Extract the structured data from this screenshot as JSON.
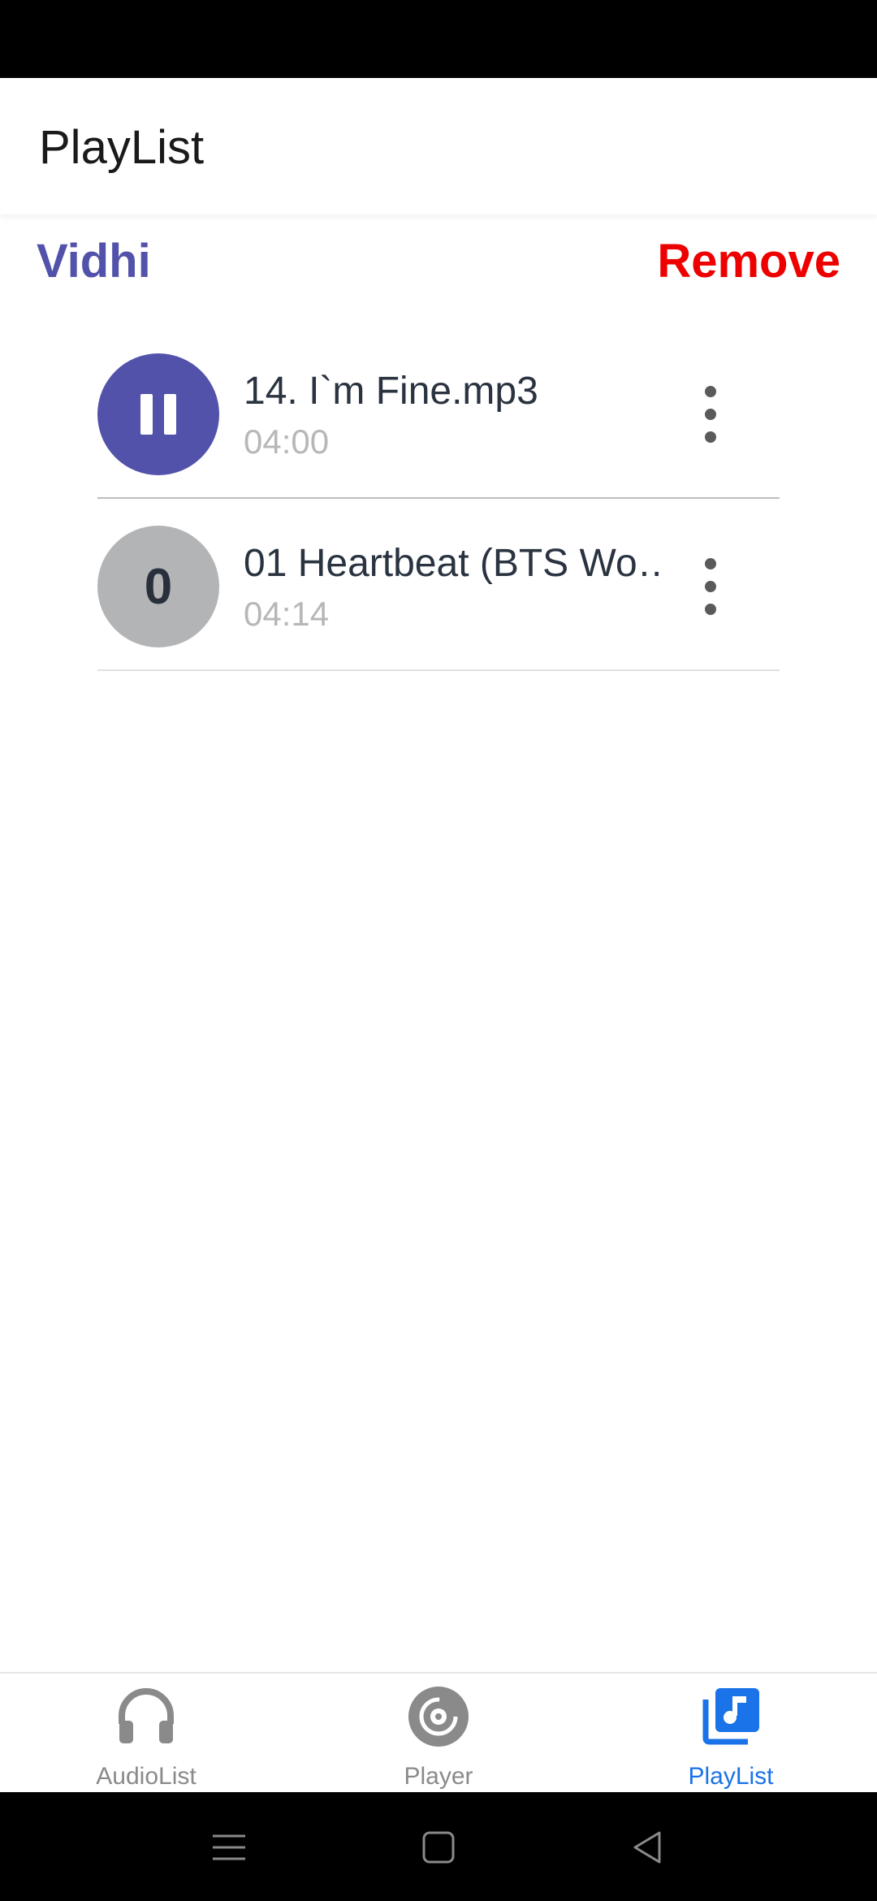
{
  "header": {
    "title": "PlayList"
  },
  "playlist": {
    "name": "Vidhi",
    "remove_label": "Remove"
  },
  "tracks": [
    {
      "title": "14. I`m Fine.mp3",
      "duration": "04:00",
      "state": "playing",
      "avatar_icon": "pause-icon"
    },
    {
      "title": "01 Heartbeat (BTS Wo…",
      "duration": "04:14",
      "state": "idle",
      "avatar_text": "0"
    }
  ],
  "bottom_nav": {
    "tabs": [
      {
        "label": "AudioList",
        "icon": "headphones-icon",
        "active": false
      },
      {
        "label": "Player",
        "icon": "disc-icon",
        "active": false
      },
      {
        "label": "PlayList",
        "icon": "music-library-icon",
        "active": true
      }
    ]
  },
  "colors": {
    "accent": "#5252aa",
    "remove": "#ee0000",
    "nav_active": "#1a73e8",
    "nav_inactive": "#8a8a8a"
  }
}
